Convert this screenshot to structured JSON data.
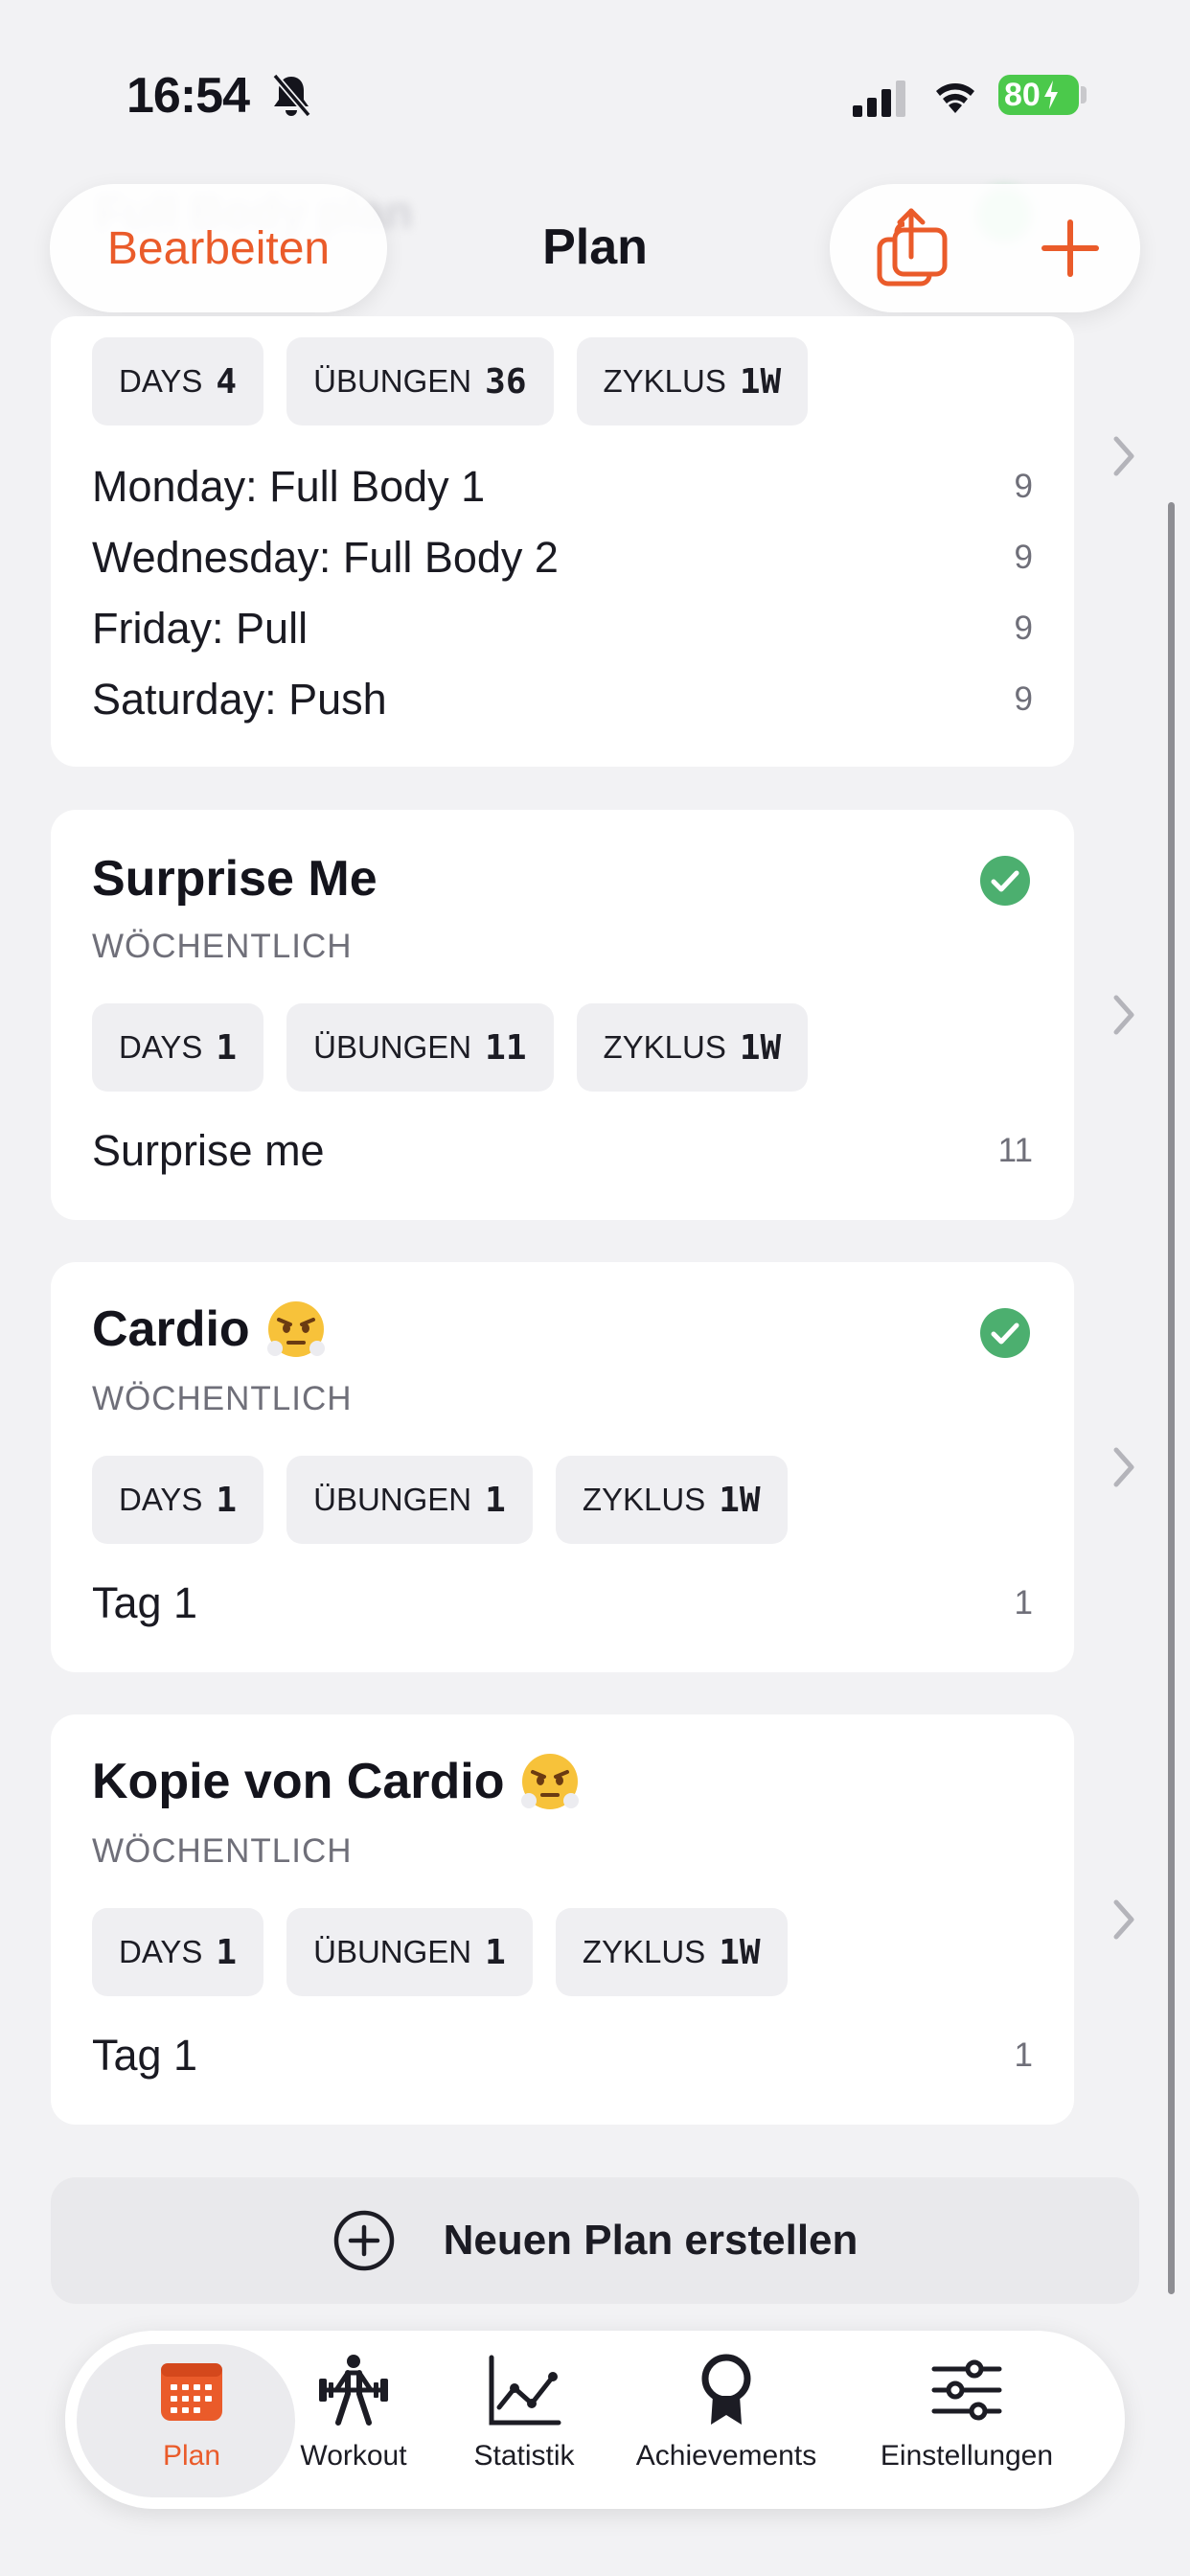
{
  "status_bar": {
    "time": "16:54",
    "battery": "80",
    "icons": [
      "bell-slash-icon",
      "signal-icon",
      "wifi-icon",
      "battery-charging-icon"
    ]
  },
  "header": {
    "edit_label": "Bearbeiten",
    "title": "Plan",
    "background_title": "Full Body plan",
    "icons": [
      "share-icon",
      "plus-icon"
    ]
  },
  "colors": {
    "accent": "#ea5b2a",
    "success": "#4caf6f",
    "chip_bg": "#efeff2"
  },
  "plans": [
    {
      "name": "",
      "frequency": "",
      "active": false,
      "chips": [
        {
          "label": "DAYS",
          "value": "4"
        },
        {
          "label": "ÜBUNGEN",
          "value": "36"
        },
        {
          "label": "ZYKLUS",
          "value": "1W"
        }
      ],
      "days": [
        {
          "label": "Monday: Full Body 1",
          "count": "9"
        },
        {
          "label": "Wednesday: Full Body 2",
          "count": "9"
        },
        {
          "label": "Friday: Pull",
          "count": "9"
        },
        {
          "label": "Saturday: Push",
          "count": "9"
        }
      ]
    },
    {
      "name": "Surprise Me",
      "frequency": "WÖCHENTLICH",
      "active": true,
      "chips": [
        {
          "label": "DAYS",
          "value": "1"
        },
        {
          "label": "ÜBUNGEN",
          "value": "11"
        },
        {
          "label": "ZYKLUS",
          "value": "1W"
        }
      ],
      "days": [
        {
          "label": "Surprise me",
          "count": "11"
        }
      ]
    },
    {
      "name": "Cardio",
      "emoji": "face-with-steam-icon",
      "frequency": "WÖCHENTLICH",
      "active": true,
      "chips": [
        {
          "label": "DAYS",
          "value": "1"
        },
        {
          "label": "ÜBUNGEN",
          "value": "1"
        },
        {
          "label": "ZYKLUS",
          "value": "1W"
        }
      ],
      "days": [
        {
          "label": "Tag 1",
          "count": "1"
        }
      ]
    },
    {
      "name": "Kopie von Cardio",
      "emoji": "face-with-steam-icon",
      "frequency": "WÖCHENTLICH",
      "active": false,
      "chips": [
        {
          "label": "DAYS",
          "value": "1"
        },
        {
          "label": "ÜBUNGEN",
          "value": "1"
        },
        {
          "label": "ZYKLUS",
          "value": "1W"
        }
      ],
      "days": [
        {
          "label": "Tag 1",
          "count": "1"
        }
      ]
    }
  ],
  "new_plan_label": "Neuen Plan erstellen",
  "tabs": [
    {
      "label": "Plan",
      "icon": "calendar-icon",
      "active": true
    },
    {
      "label": "Workout",
      "icon": "weightlifter-icon",
      "active": false
    },
    {
      "label": "Statistik",
      "icon": "chart-icon",
      "active": false
    },
    {
      "label": "Achievements",
      "icon": "award-icon",
      "active": false
    },
    {
      "label": "Einstellungen",
      "icon": "sliders-icon",
      "active": false
    }
  ]
}
